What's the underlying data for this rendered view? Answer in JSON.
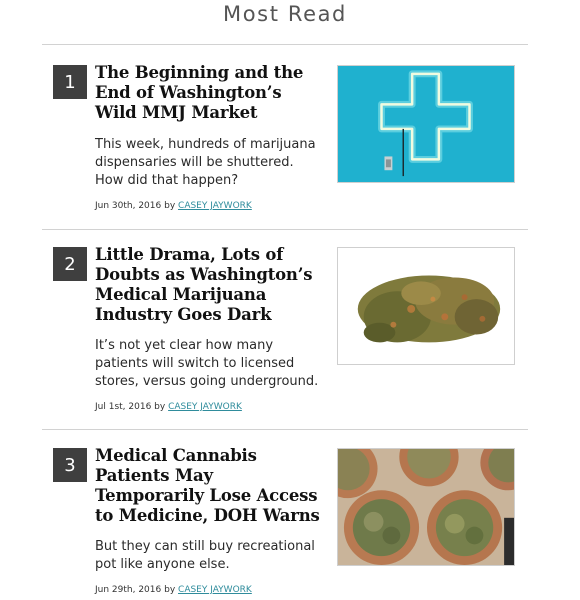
{
  "section": {
    "title": "Most Read"
  },
  "articles": [
    {
      "rank": "1",
      "title": "The Beginning and the End of Washington’s Wild MMJ Market",
      "summary": "This week, hundreds of marijuana dispensaries will be shuttered. How did that happen?",
      "date": "Jun 30th, 2016",
      "by": "by",
      "author": "CASEY JAYWORK",
      "image": "neon-cross-image"
    },
    {
      "rank": "2",
      "title": "Little Drama, Lots of Doubts as Washington’s Medical Marijuana Industry Goes Dark",
      "summary": "It’s not yet clear how many patients will switch to licensed stores, versus going underground.",
      "date": "Jul 1st, 2016",
      "by": "by",
      "author": "CASEY JAYWORK",
      "image": "cannabis-bud-image"
    },
    {
      "rank": "3",
      "title": "Medical Cannabis Patients May Temporarily Lose Access to Medicine, DOH Warns",
      "summary": "But they can still buy recreational pot like anyone else.",
      "date": "Jun 29th, 2016",
      "by": "by",
      "author": "CASEY JAYWORK",
      "image": "cannabis-bowls-image"
    }
  ],
  "colors": {
    "rank_badge": "#3f3f3f",
    "author_link": "#2f8c9c",
    "divider": "#d2d2d2",
    "cross_background": "#1fb1cf"
  }
}
